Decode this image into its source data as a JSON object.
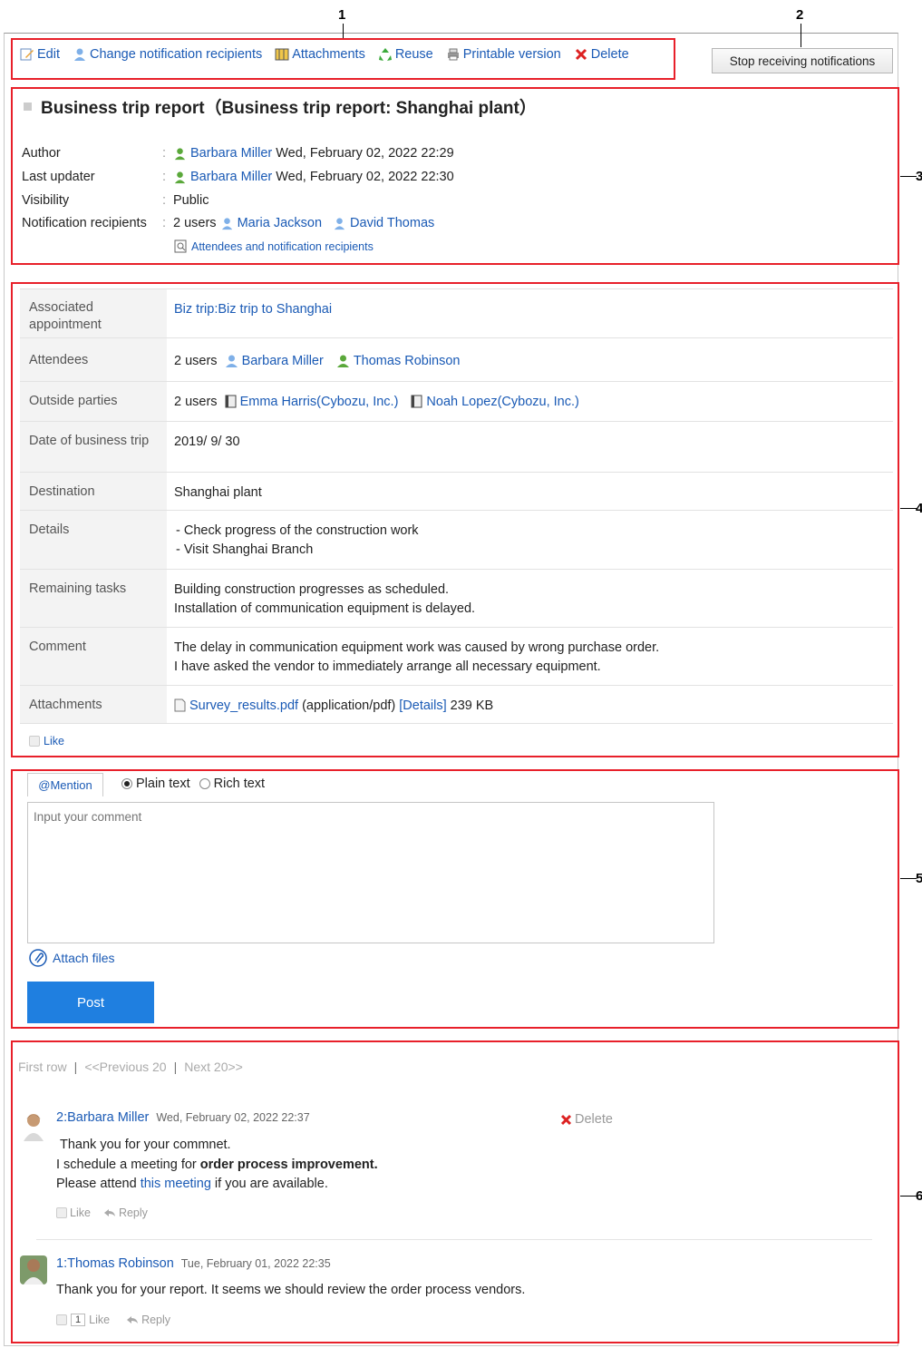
{
  "callouts": {
    "n1": "1",
    "n2": "2",
    "n3": "3",
    "n4": "4",
    "n5": "5",
    "n6": "6"
  },
  "toolbar": {
    "edit": "Edit",
    "change_recipients": "Change notification recipients",
    "attachments": "Attachments",
    "reuse": "Reuse",
    "printable": "Printable version",
    "delete": "Delete",
    "stop_notifications": "Stop receiving notifications"
  },
  "record": {
    "title": "Business trip report（Business trip report: Shanghai plant）",
    "author_label": "Author",
    "author_name": "Barbara Miller",
    "author_date": "Wed, February 02, 2022 22:29",
    "updater_label": "Last updater",
    "updater_name": "Barbara Miller",
    "updater_date": "Wed, February 02, 2022 22:30",
    "visibility_label": "Visibility",
    "visibility_value": "Public",
    "recipients_label": "Notification recipients",
    "recipients_count": "2 users",
    "recipient_1": "Maria Jackson",
    "recipient_2": "David Thomas",
    "attendees_link": "Attendees and notification recipients"
  },
  "details": {
    "assoc_label": "Associated appointment",
    "assoc_value": "Biz trip:Biz trip to Shanghai",
    "attendees_label": "Attendees",
    "attendees_count": "2 users",
    "attendee_1": "Barbara Miller",
    "attendee_2": "Thomas Robinson",
    "outside_label": "Outside parties",
    "outside_count": "2 users",
    "outside_1": "Emma Harris(Cybozu, Inc.)",
    "outside_2": "Noah Lopez(Cybozu, Inc.)",
    "date_label": "Date of business trip",
    "date_value": "2019/ 9/ 30",
    "dest_label": "Destination",
    "dest_value": "Shanghai plant",
    "details_label": "Details",
    "details_line1": "- Check progress of the construction work",
    "details_line2": "- Visit Shanghai Branch",
    "tasks_label": "Remaining tasks",
    "tasks_line1": "Building construction progresses as scheduled.",
    "tasks_line2": "Installation of communication equipment is delayed.",
    "comment_label": "Comment",
    "comment_line1": "The delay in communication equipment work was caused by wrong purchase order.",
    "comment_line2": "I have asked the vendor to immediately arrange all necessary equipment.",
    "attach_label": "Attachments",
    "attach_file": "Survey_results.pdf",
    "attach_type": "(application/pdf)",
    "attach_details": "[Details]",
    "attach_size": "239 KB",
    "like": "Like"
  },
  "form": {
    "mention": "@Mention",
    "plain": "Plain text",
    "rich": "Rich text",
    "placeholder": "Input your comment",
    "attach_files": "Attach files",
    "post": "Post"
  },
  "pager": {
    "first": "First row",
    "sep": "|",
    "prev": "<<Previous 20",
    "next": "Next 20>>"
  },
  "comments": [
    {
      "num": "2:",
      "author": "Barbara Miller",
      "date": "Wed, February 02, 2022 22:37",
      "line1": "Thank you for your commnet.",
      "line2_pre": "I schedule a meeting for ",
      "line2_bold": "order process improvement.",
      "line3_pre": "Please attend ",
      "line3_link": "this meeting",
      "line3_post": " if you are available.",
      "like": "Like",
      "reply": "Reply",
      "delete": "Delete"
    },
    {
      "num": "1:",
      "author": "Thomas Robinson",
      "date": "Tue, February 01, 2022 22:35",
      "line1": "Thank you for your report. It seems we should review the order process vendors.",
      "like_count": "1",
      "like": "Like",
      "reply": "Reply"
    }
  ],
  "colors": {
    "accent": "#1a5ab5",
    "callout_red": "#e8202a",
    "post_button": "#1f7fe0"
  }
}
